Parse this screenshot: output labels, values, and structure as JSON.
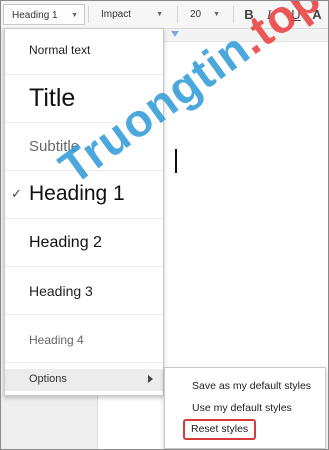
{
  "toolbar": {
    "style_value": "Heading 1",
    "font_value": "Impact",
    "size_value": "20",
    "bold_label": "B",
    "italic_label": "I",
    "underline_label": "U",
    "color_label": "A",
    "caret_icon": "caret-down-icon"
  },
  "style_menu": {
    "items": [
      {
        "label": "Normal text"
      },
      {
        "label": "Title"
      },
      {
        "label": "Subtitle"
      },
      {
        "label": "Heading 1",
        "checked": true
      },
      {
        "label": "Heading 2"
      },
      {
        "label": "Heading 3"
      },
      {
        "label": "Heading 4"
      }
    ],
    "check_glyph": "✓",
    "options_label": "Options",
    "options_arrow_icon": "chevron-right-icon"
  },
  "options_menu": {
    "items": [
      {
        "label": "Save as my default styles"
      },
      {
        "label": "Use my default styles"
      },
      {
        "label": "Reset styles"
      }
    ],
    "highlight_color": "#d63b3b"
  },
  "watermark": {
    "part1": "Truongtin",
    "part2": ".top"
  },
  "colors": {
    "accent_ruler": "#7fa7e8",
    "watermark_blue": "#2c9ad6",
    "watermark_red": "#ea3b3b"
  }
}
